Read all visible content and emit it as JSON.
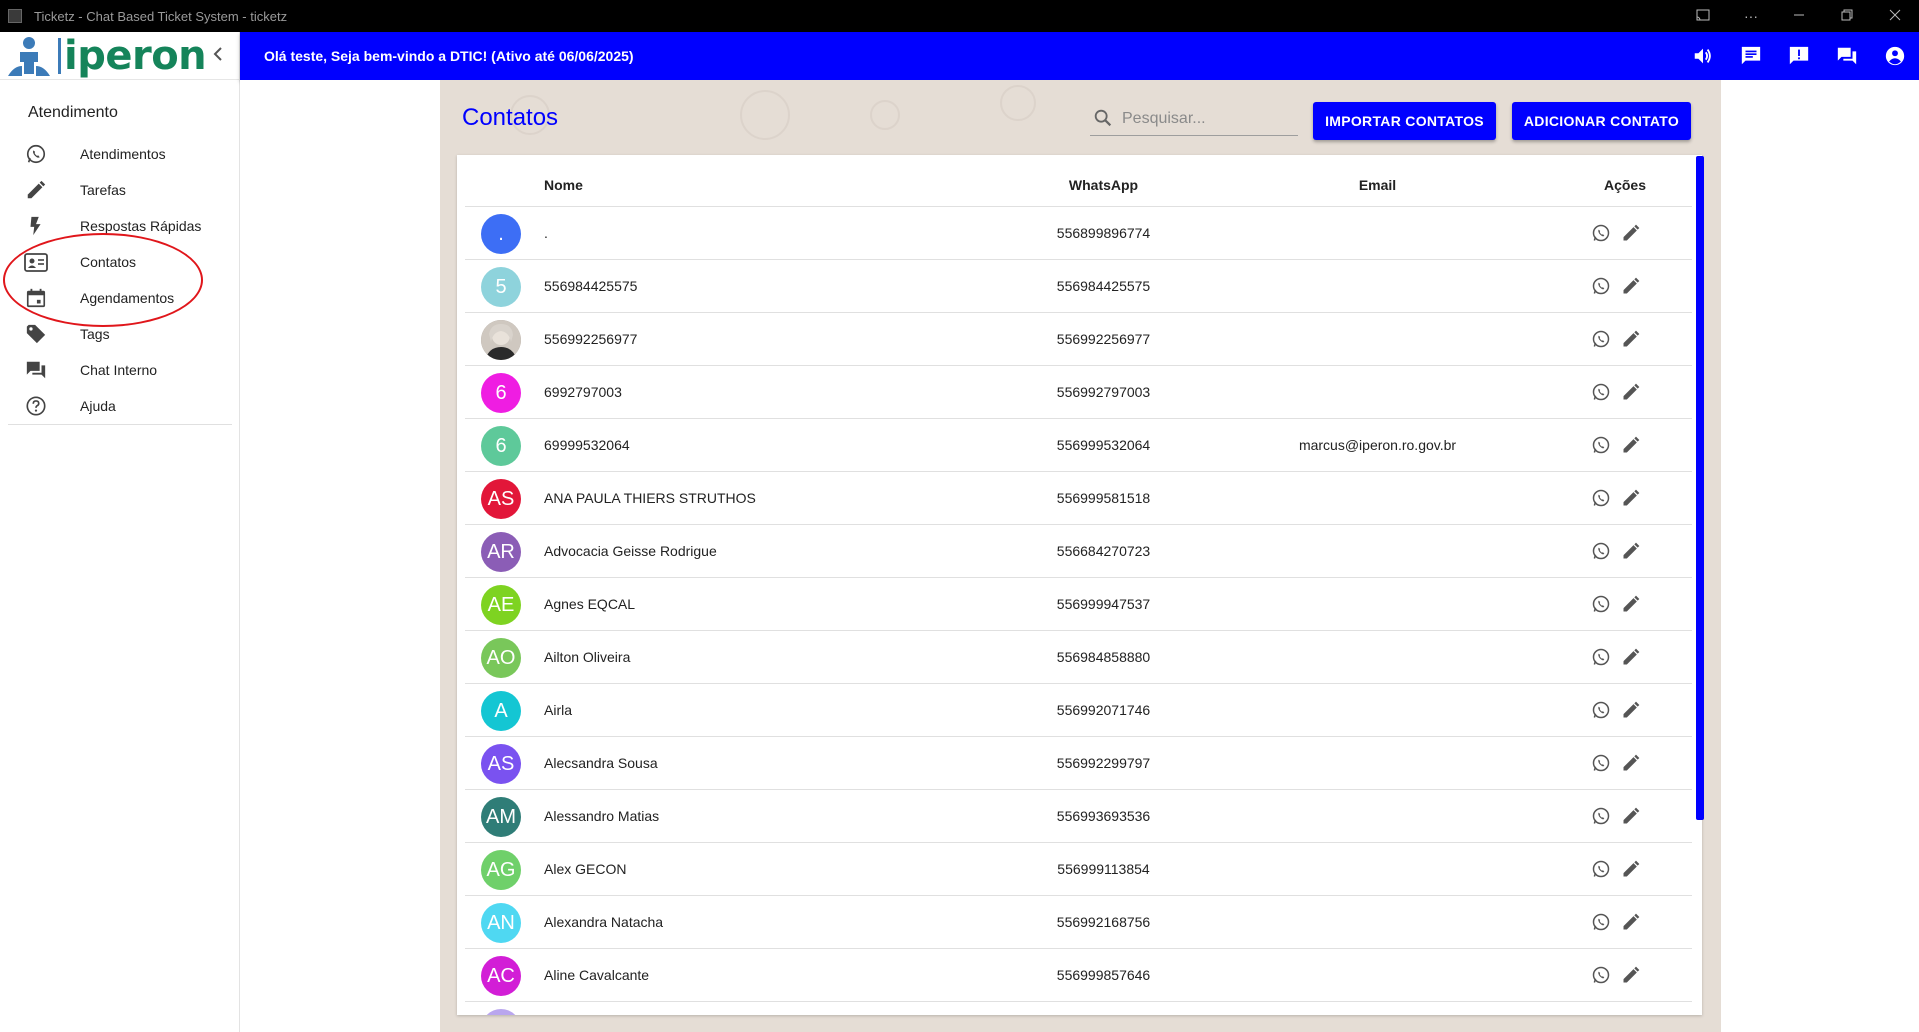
{
  "window": {
    "title": "Ticketz - Chat Based Ticket System - ticketz",
    "controls": [
      "minimize",
      "restore",
      "close"
    ]
  },
  "brand": {
    "logo_text": "iperon",
    "colors": {
      "green": "#15845a",
      "blue": "#3c7bb8"
    }
  },
  "sidebar": {
    "section_title": "Atendimento",
    "items": [
      {
        "label": "Atendimentos",
        "icon": "whatsapp-icon"
      },
      {
        "label": "Tarefas",
        "icon": "pencil-icon"
      },
      {
        "label": "Respostas Rápidas",
        "icon": "flash-icon"
      },
      {
        "label": "Contatos",
        "icon": "contact-card-icon"
      },
      {
        "label": "Agendamentos",
        "icon": "calendar-icon"
      },
      {
        "label": "Tags",
        "icon": "tag-icon"
      },
      {
        "label": "Chat Interno",
        "icon": "forum-icon"
      },
      {
        "label": "Ajuda",
        "icon": "help-icon"
      }
    ],
    "highlighted_item": "Contatos"
  },
  "appbar": {
    "greeting": "Olá teste, Seja bem-vindo a DTIC! (Ativo até 06/06/2025)",
    "icons": [
      "volume-icon",
      "chat-icon",
      "announcement-icon",
      "forum-icon",
      "account-icon"
    ],
    "color": "#0000ff"
  },
  "page": {
    "title": "Contatos",
    "search_placeholder": "Pesquisar...",
    "import_button": "IMPORTAR CONTATOS",
    "add_button": "ADICIONAR CONTATO"
  },
  "table": {
    "headers": {
      "name": "Nome",
      "whatsapp": "WhatsApp",
      "email": "Email",
      "actions": "Ações"
    },
    "rows": [
      {
        "initials": ".",
        "color": "#3d6ef5",
        "name": ".",
        "whatsapp": "556899896774",
        "email": ""
      },
      {
        "initials": "5",
        "color": "#8ed3dc",
        "name": "556984425575",
        "whatsapp": "556984425575",
        "email": ""
      },
      {
        "initials": "",
        "color": "#9a8f86",
        "photo": true,
        "name": "556992256977",
        "whatsapp": "556992256977",
        "email": ""
      },
      {
        "initials": "6",
        "color": "#ef1de2",
        "name": "6992797003",
        "whatsapp": "556992797003",
        "email": ""
      },
      {
        "initials": "6",
        "color": "#5ec99a",
        "name": "69999532064",
        "whatsapp": "556999532064",
        "email": "marcus@iperon.ro.gov.br"
      },
      {
        "initials": "AS",
        "color": "#e21639",
        "name": "ANA PAULA THIERS STRUTHOS",
        "whatsapp": "556999581518",
        "email": ""
      },
      {
        "initials": "AR",
        "color": "#8b5db6",
        "name": "Advocacia Geisse Rodrigue",
        "whatsapp": "556684270723",
        "email": ""
      },
      {
        "initials": "AE",
        "color": "#7ed321",
        "name": "Agnes EQCAL",
        "whatsapp": "556999947537",
        "email": ""
      },
      {
        "initials": "AO",
        "color": "#79c75a",
        "name": "Ailton Oliveira",
        "whatsapp": "556984858880",
        "email": ""
      },
      {
        "initials": "A",
        "color": "#14c6d3",
        "name": "Airla",
        "whatsapp": "556992071746",
        "email": ""
      },
      {
        "initials": "AS",
        "color": "#7a52f0",
        "name": "Alecsandra Sousa",
        "whatsapp": "556992299797",
        "email": ""
      },
      {
        "initials": "AM",
        "color": "#2f7d77",
        "name": "Alessandro Matias",
        "whatsapp": "556993693536",
        "email": ""
      },
      {
        "initials": "AG",
        "color": "#6fd06a",
        "name": "Alex GECON",
        "whatsapp": "556999113854",
        "email": ""
      },
      {
        "initials": "AN",
        "color": "#4fd8f2",
        "name": "Alexandra Natacha",
        "whatsapp": "556992168756",
        "email": ""
      },
      {
        "initials": "AC",
        "color": "#d21ed6",
        "name": "Aline Cavalcante",
        "whatsapp": "556999857646",
        "email": ""
      },
      {
        "initials": "",
        "color": "#b9a6ee",
        "name": "",
        "whatsapp": "",
        "email": ""
      }
    ]
  }
}
